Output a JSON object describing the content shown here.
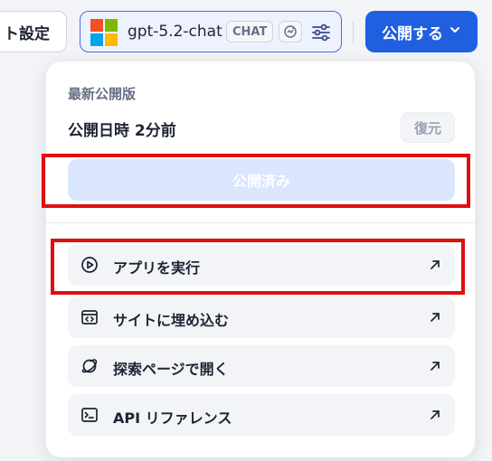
{
  "topbar": {
    "settings_label": "ト設定",
    "model": {
      "name": "gpt-5.2-chat",
      "tag": "CHAT",
      "logo_icon": "microsoft-logo",
      "vision_icon": "vision-icon",
      "settings_icon": "tune-icon"
    },
    "publish_label": "公開する",
    "publish_icon": "chevron-down-icon"
  },
  "dropdown": {
    "section_label": "最新公開版",
    "publish_time": "公開日時 2分前",
    "restore_label": "復元",
    "published_label": "公開済み",
    "items": [
      {
        "label": "アプリを実行",
        "icon": "play-circle-icon",
        "arrow_icon": "arrow-up-right-icon"
      },
      {
        "label": "サイトに埋め込む",
        "icon": "embed-code-icon",
        "arrow_icon": "arrow-up-right-icon"
      },
      {
        "label": "探索ページで開く",
        "icon": "planet-icon",
        "arrow_icon": "arrow-up-right-icon"
      },
      {
        "label": "API リファレンス",
        "icon": "terminal-icon",
        "arrow_icon": "arrow-up-right-icon"
      }
    ]
  },
  "colors": {
    "accent": "#1f5fe0",
    "published_disabled": "#d9e6fd",
    "highlight": "#e00f0f"
  }
}
